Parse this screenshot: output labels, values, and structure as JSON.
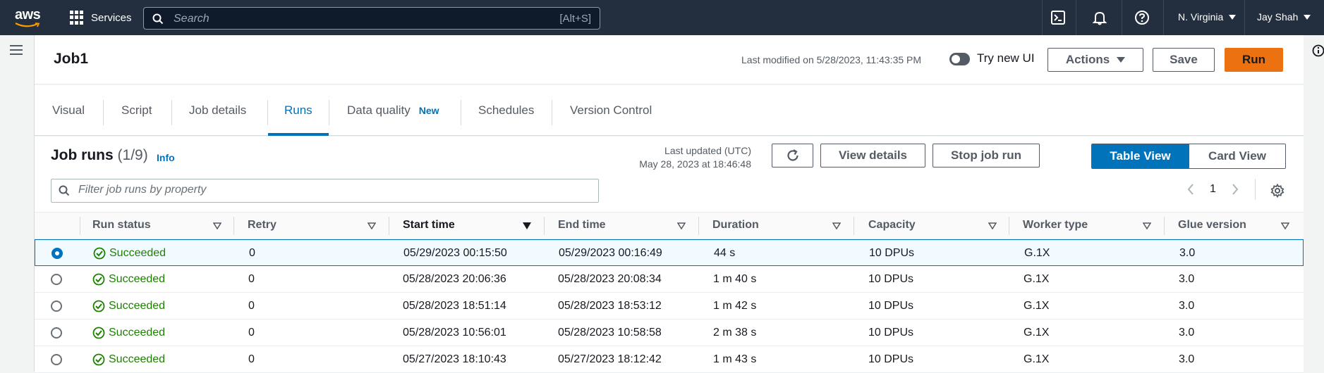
{
  "topnav": {
    "logo_text": "aws",
    "services_label": "Services",
    "search_placeholder": "Search",
    "search_shortcut": "[Alt+S]",
    "region": "N. Virginia",
    "user": "Jay Shah"
  },
  "header": {
    "title": "Job1",
    "last_modified": "Last modified on 5/28/2023, 11:43:35 PM",
    "try_new_ui": "Try new UI",
    "actions_label": "Actions",
    "save_label": "Save",
    "run_label": "Run"
  },
  "tabs": [
    {
      "label": "Visual"
    },
    {
      "label": "Script"
    },
    {
      "label": "Job details"
    },
    {
      "label": "Runs",
      "active": true
    },
    {
      "label": "Data quality",
      "badge": "New"
    },
    {
      "label": "Schedules"
    },
    {
      "label": "Version Control"
    }
  ],
  "runs": {
    "title": "Job runs",
    "count": "(1/9)",
    "info_link": "Info",
    "last_updated_label": "Last updated (UTC)",
    "last_updated_value": "May 28, 2023 at 18:46:48",
    "view_details_label": "View details",
    "stop_job_run_label": "Stop job run",
    "table_view_label": "Table View",
    "card_view_label": "Card View",
    "filter_placeholder": "Filter job runs by property",
    "page": "1",
    "columns": [
      "Run status",
      "Retry",
      "Start time",
      "End time",
      "Duration",
      "Capacity",
      "Worker type",
      "Glue version"
    ],
    "rows": [
      {
        "status": "Succeeded",
        "retry": "0",
        "start": "05/29/2023 00:15:50",
        "end": "05/29/2023 00:16:49",
        "duration": "44 s",
        "capacity": "10 DPUs",
        "worker": "G.1X",
        "glue": "3.0",
        "selected": true
      },
      {
        "status": "Succeeded",
        "retry": "0",
        "start": "05/28/2023 20:06:36",
        "end": "05/28/2023 20:08:34",
        "duration": "1 m 40 s",
        "capacity": "10 DPUs",
        "worker": "G.1X",
        "glue": "3.0"
      },
      {
        "status": "Succeeded",
        "retry": "0",
        "start": "05/28/2023 18:51:14",
        "end": "05/28/2023 18:53:12",
        "duration": "1 m 42 s",
        "capacity": "10 DPUs",
        "worker": "G.1X",
        "glue": "3.0"
      },
      {
        "status": "Succeeded",
        "retry": "0",
        "start": "05/28/2023 10:56:01",
        "end": "05/28/2023 10:58:58",
        "duration": "2 m 38 s",
        "capacity": "10 DPUs",
        "worker": "G.1X",
        "glue": "3.0"
      },
      {
        "status": "Succeeded",
        "retry": "0",
        "start": "05/27/2023 18:10:43",
        "end": "05/27/2023 18:12:42",
        "duration": "1 m 43 s",
        "capacity": "10 DPUs",
        "worker": "G.1X",
        "glue": "3.0"
      }
    ]
  },
  "colors": {
    "nav_bg": "#232f3e",
    "accent": "#0073bb",
    "run_button": "#ec7211",
    "success": "#1d8102"
  }
}
